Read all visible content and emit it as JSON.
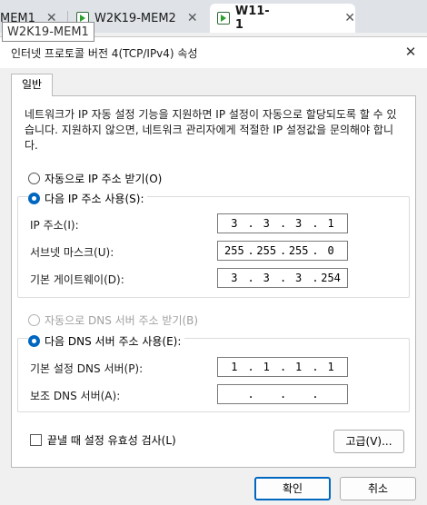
{
  "host_tabs": {
    "tab1_label": "MEM1",
    "tab2_label": "W2K19-MEM2",
    "tab3_label": "W11-1",
    "close_glyph": "✕",
    "tooltip": "W2K19-MEM1"
  },
  "dialog": {
    "title": "인터넷 프로토콜 버전 4(TCP/IPv4) 속성",
    "tab_general": "일반",
    "description": "네트워크가 IP 자동 설정 기능을 지원하면 IP 설정이 자동으로 할당되도록 할 수 있습니다. 지원하지 않으면, 네트워크 관리자에게 적절한 IP 설정값을 문의해야 합니다.",
    "ip_auto_label": "자동으로 IP 주소 받기(O)",
    "ip_manual_label": "다음 IP 주소 사용(S):",
    "ip_address_label": "IP 주소(I):",
    "ip_address": [
      "3",
      "3",
      "3",
      "1"
    ],
    "subnet_label": "서브넷 마스크(U):",
    "subnet": [
      "255",
      "255",
      "255",
      "0"
    ],
    "gateway_label": "기본 게이트웨이(D):",
    "gateway": [
      "3",
      "3",
      "3",
      "254"
    ],
    "dns_auto_label": "자동으로 DNS 서버 주소 받기(B)",
    "dns_manual_label": "다음 DNS 서버 주소 사용(E):",
    "dns_preferred_label": "기본 설정 DNS 서버(P):",
    "dns_preferred": [
      "1",
      "1",
      "1",
      "1"
    ],
    "dns_alternate_label": "보조 DNS 서버(A):",
    "dns_alternate": [
      "",
      "",
      "",
      ""
    ],
    "validate_label": "끝낼 때 설정 유효성 검사(L)",
    "advanced_label": "고급(V)...",
    "ok_label": "확인",
    "cancel_label": "취소"
  },
  "colors": {
    "accent": "#0067c0",
    "tab_strip": "#dfe3e8"
  }
}
